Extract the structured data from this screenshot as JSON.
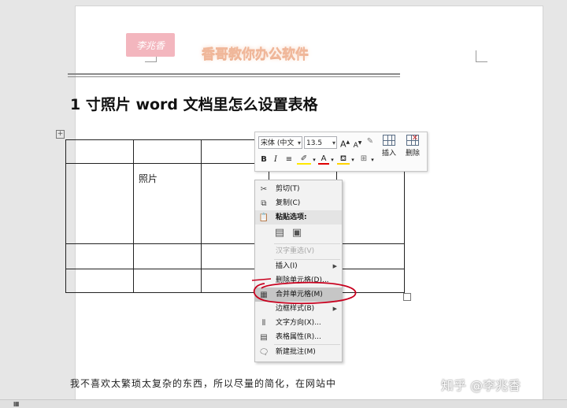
{
  "header": {
    "seal_text": "李兆香",
    "logo_text": "香哥教你办公软件"
  },
  "document": {
    "heading": "1 寸照片 word 文档里怎么设置表格",
    "photo_cell": "照片",
    "body_text": "我不喜欢太繁琐太复杂的东西，所以尽量的简化，在网站中"
  },
  "toolbar": {
    "font_name": "宋体 (中文",
    "font_size": "13.5",
    "grow_font": "A",
    "shrink_font": "A",
    "bold": "B",
    "italic": "I",
    "font_color_label": "A",
    "insert_label": "插入",
    "delete_label": "删除"
  },
  "context_menu": {
    "cut": "剪切(T)",
    "copy": "复制(C)",
    "paste_options": "粘贴选项:",
    "hanzi": "汉字重选(V)",
    "insert": "插入(I)",
    "delete_cells": "删除单元格(D)...",
    "merge_cells": "合并单元格(M)",
    "border_styles": "边框样式(B)",
    "text_direction": "文字方向(X)...",
    "table_properties": "表格属性(R)...",
    "new_comment": "新建批注(M)"
  },
  "watermark": "知乎 @李兆香",
  "colors": {
    "seal_bg": "#f3b6be",
    "logo_text": "#f0b79a",
    "annotation_red": "#c8001e",
    "menu_highlight": "#c6c6c6"
  }
}
